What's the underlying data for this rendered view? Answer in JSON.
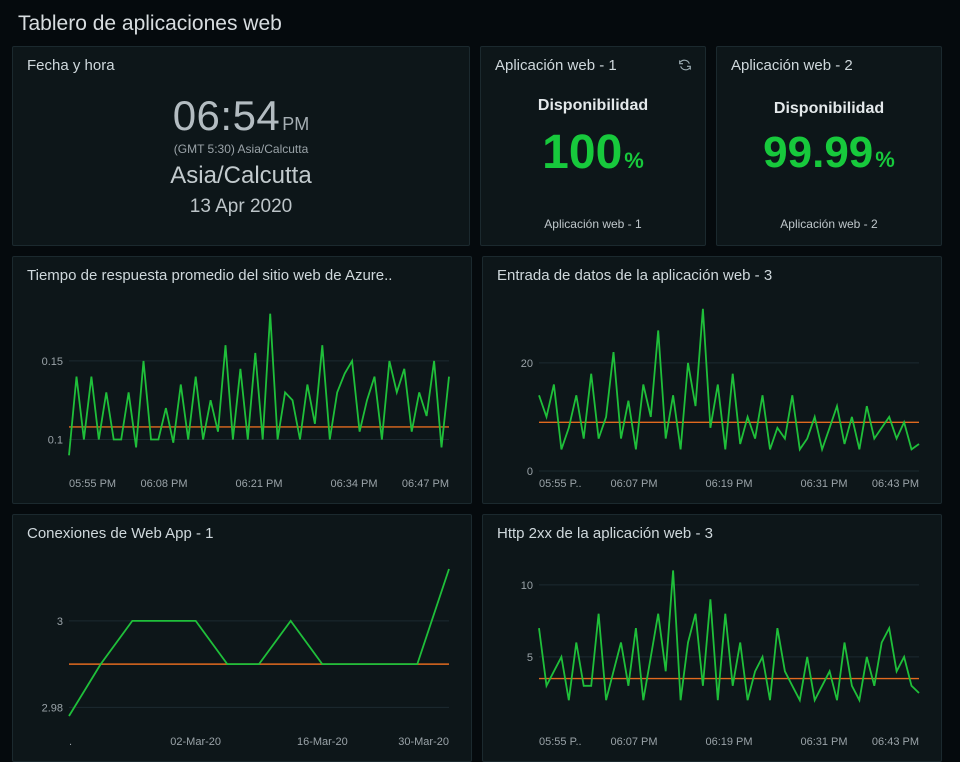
{
  "dashboard_title": "Tablero de aplicaciones web",
  "colors": {
    "green": "#1fbf3a",
    "orange": "#e06a1f",
    "panel_bg": "#0d1619"
  },
  "datetime_panel": {
    "title": "Fecha y hora",
    "time": "06:54",
    "meridiem": "PM",
    "tz_offset": "(GMT 5:30) Asia/Calcutta",
    "zone": "Asia/Calcutta",
    "date": "13 Apr 2020"
  },
  "avail1": {
    "title": "Aplicación web - 1",
    "metric_label": "Disponibilidad",
    "value": "100",
    "unit": "%",
    "footer": "Aplicación web - 1"
  },
  "avail2": {
    "title": "Aplicación web - 2",
    "metric_label": "Disponibilidad",
    "value": "99.99",
    "unit": "%",
    "footer": "Aplicación web - 2"
  },
  "chart_data": [
    {
      "id": "response_time",
      "title": "Tiempo de respuesta promedio del sitio web de Azure..",
      "type": "line",
      "x_ticks": [
        "05:55 PM",
        "06:08 PM",
        "06:21 PM",
        "06:34 PM",
        "06:47 PM"
      ],
      "y_ticks": [
        0.1,
        0.15
      ],
      "ylim": [
        0.08,
        0.19
      ],
      "baseline": 0.108,
      "series": [
        {
          "name": "response",
          "color": "green",
          "values": [
            0.09,
            0.14,
            0.1,
            0.14,
            0.1,
            0.13,
            0.1,
            0.1,
            0.13,
            0.095,
            0.15,
            0.1,
            0.1,
            0.12,
            0.098,
            0.135,
            0.1,
            0.14,
            0.1,
            0.125,
            0.105,
            0.16,
            0.1,
            0.145,
            0.1,
            0.155,
            0.1,
            0.18,
            0.1,
            0.13,
            0.125,
            0.1,
            0.135,
            0.11,
            0.16,
            0.1,
            0.13,
            0.142,
            0.15,
            0.105,
            0.125,
            0.14,
            0.1,
            0.15,
            0.13,
            0.145,
            0.105,
            0.13,
            0.115,
            0.15,
            0.095,
            0.14
          ]
        }
      ]
    },
    {
      "id": "data_in",
      "title": "Entrada de datos de la aplicación web - 3",
      "type": "line",
      "x_ticks": [
        "05:55 P..",
        "06:07 PM",
        "06:19 PM",
        "06:31 PM",
        "06:43 PM"
      ],
      "y_ticks": [
        0,
        20
      ],
      "ylim": [
        0,
        32
      ],
      "baseline": 9,
      "series": [
        {
          "name": "data-in",
          "color": "green",
          "values": [
            14,
            10,
            16,
            4,
            8,
            14,
            6,
            18,
            6,
            10,
            22,
            6,
            13,
            4,
            16,
            10,
            26,
            6,
            14,
            4,
            20,
            12,
            30,
            8,
            16,
            4,
            18,
            5,
            10,
            6,
            14,
            4,
            8,
            6,
            14,
            4,
            6,
            10,
            4,
            8,
            12,
            5,
            10,
            4,
            12,
            6,
            8,
            10,
            6,
            9,
            4,
            5
          ]
        }
      ]
    },
    {
      "id": "connections",
      "title": "Conexiones de Web App - 1",
      "type": "line",
      "x_ticks": [
        ".",
        "02-Mar-20",
        "16-Mar-20",
        "30-Mar-20"
      ],
      "y_ticks": [
        2.98,
        3
      ],
      "ylim": [
        2.975,
        3.015
      ],
      "baseline": 2.99,
      "series": [
        {
          "name": "connections",
          "color": "green",
          "values": [
            2.978,
            2.99,
            3.0,
            3.0,
            3.0,
            2.99,
            2.99,
            3.0,
            2.99,
            2.99,
            2.99,
            2.99,
            3.012
          ]
        }
      ]
    },
    {
      "id": "http2xx",
      "title": "Http 2xx de la aplicación web - 3",
      "type": "line",
      "x_ticks": [
        "05:55 P..",
        "06:07 PM",
        "06:19 PM",
        "06:31 PM",
        "06:43 PM"
      ],
      "y_ticks": [
        5,
        10
      ],
      "ylim": [
        0,
        12
      ],
      "baseline": 3.5,
      "series": [
        {
          "name": "http2xx",
          "color": "green",
          "values": [
            7,
            3,
            4,
            5,
            2,
            6,
            3,
            3,
            8,
            2,
            4,
            6,
            3,
            7,
            2,
            5,
            8,
            4,
            11,
            2,
            6,
            8,
            3,
            9,
            2,
            8,
            3,
            6,
            2,
            4,
            5,
            2,
            7,
            4,
            3,
            2,
            5,
            2,
            3,
            4,
            2,
            6,
            3,
            2,
            5,
            3,
            6,
            7,
            4,
            5,
            3,
            2.5
          ]
        }
      ]
    }
  ]
}
